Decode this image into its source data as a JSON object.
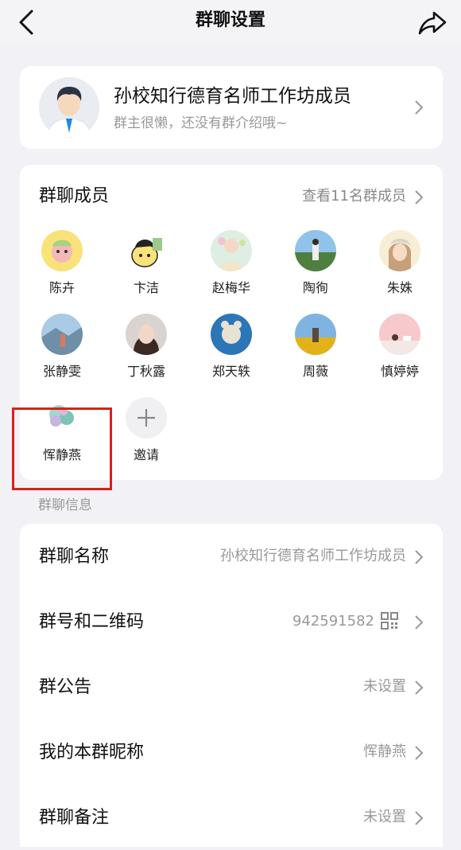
{
  "nav": {
    "title": "群聊设置"
  },
  "group": {
    "name": "孙校知行德育名师工作坊成员",
    "intro": "群主很懒，还没有群介绍哦~"
  },
  "members": {
    "title": "群聊成员",
    "view_all": "查看11名群成员",
    "list": [
      {
        "name": "陈卉"
      },
      {
        "name": "卞洁"
      },
      {
        "name": "赵梅华"
      },
      {
        "name": "陶徇"
      },
      {
        "name": "朱姝"
      },
      {
        "name": "张静雯"
      },
      {
        "name": "丁秋露"
      },
      {
        "name": "郑天轶"
      },
      {
        "name": "周薇"
      },
      {
        "name": "慎婷婷"
      },
      {
        "name": "恽静燕"
      }
    ],
    "invite_label": "邀请"
  },
  "info_section": {
    "label": "群聊信息",
    "rows": [
      {
        "label": "群聊名称",
        "value": "孙校知行德育名师工作坊成员"
      },
      {
        "label": "群号和二维码",
        "value": "942591582"
      },
      {
        "label": "群公告",
        "value": "未设置"
      },
      {
        "label": "我的本群昵称",
        "value": "恽静燕"
      },
      {
        "label": "群聊备注",
        "value": "未设置"
      }
    ]
  },
  "colors": {
    "highlight": "#d9201f",
    "background": "#f2f2f6"
  }
}
